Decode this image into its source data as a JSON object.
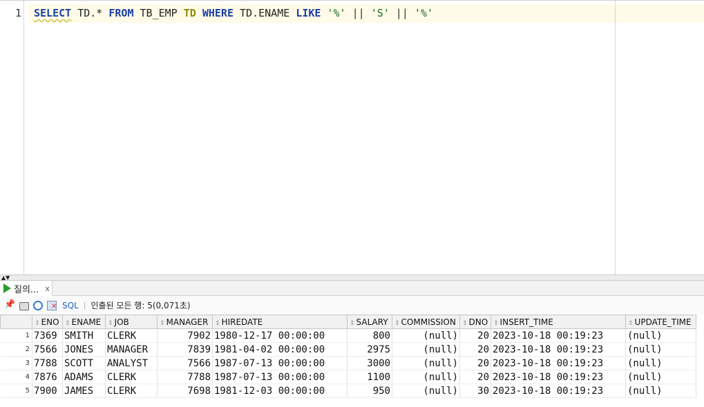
{
  "editor": {
    "line_number": "1",
    "tokens": {
      "select": "SELECT",
      "td_star": " TD.* ",
      "from": "FROM",
      "table": " TB_EMP ",
      "alias": "TD",
      "sp1": " ",
      "where": "WHERE",
      "col": " TD.ENAME ",
      "like": "LIKE",
      "sp2": " ",
      "s1": "'%'",
      "p1": " || ",
      "s2": "'S'",
      "p2": " || ",
      "s3": "'%'"
    }
  },
  "results_tab": {
    "label": "질의...",
    "close": "x"
  },
  "toolbar": {
    "sql_label": "SQL",
    "separator": "|",
    "status": "인출된 모든 행: 5(0,071초)"
  },
  "grid": {
    "columns": [
      "ENO",
      "ENAME",
      "JOB",
      "MANAGER",
      "HIREDATE",
      "SALARY",
      "COMMISSION",
      "DNO",
      "INSERT_TIME",
      "UPDATE_TIME"
    ],
    "rows": [
      {
        "n": "1",
        "eno": "7369",
        "ename": "SMITH",
        "job": "CLERK",
        "manager": "7902",
        "hiredate": "1980-12-17  00:00:00",
        "salary": "800",
        "commission": "(null)",
        "dno": "20",
        "insert_time": "2023-10-18  00:19:23",
        "update_time": "(null)"
      },
      {
        "n": "2",
        "eno": "7566",
        "ename": "JONES",
        "job": "MANAGER",
        "manager": "7839",
        "hiredate": "1981-04-02  00:00:00",
        "salary": "2975",
        "commission": "(null)",
        "dno": "20",
        "insert_time": "2023-10-18  00:19:23",
        "update_time": "(null)"
      },
      {
        "n": "3",
        "eno": "7788",
        "ename": "SCOTT",
        "job": "ANALYST",
        "manager": "7566",
        "hiredate": "1987-07-13  00:00:00",
        "salary": "3000",
        "commission": "(null)",
        "dno": "20",
        "insert_time": "2023-10-18  00:19:23",
        "update_time": "(null)"
      },
      {
        "n": "4",
        "eno": "7876",
        "ename": "ADAMS",
        "job": "CLERK",
        "manager": "7788",
        "hiredate": "1987-07-13  00:00:00",
        "salary": "1100",
        "commission": "(null)",
        "dno": "20",
        "insert_time": "2023-10-18  00:19:23",
        "update_time": "(null)"
      },
      {
        "n": "5",
        "eno": "7900",
        "ename": "JAMES",
        "job": "CLERK",
        "manager": "7698",
        "hiredate": "1981-12-03  00:00:00",
        "salary": "950",
        "commission": "(null)",
        "dno": "30",
        "insert_time": "2023-10-18  00:19:23",
        "update_time": "(null)"
      }
    ]
  }
}
